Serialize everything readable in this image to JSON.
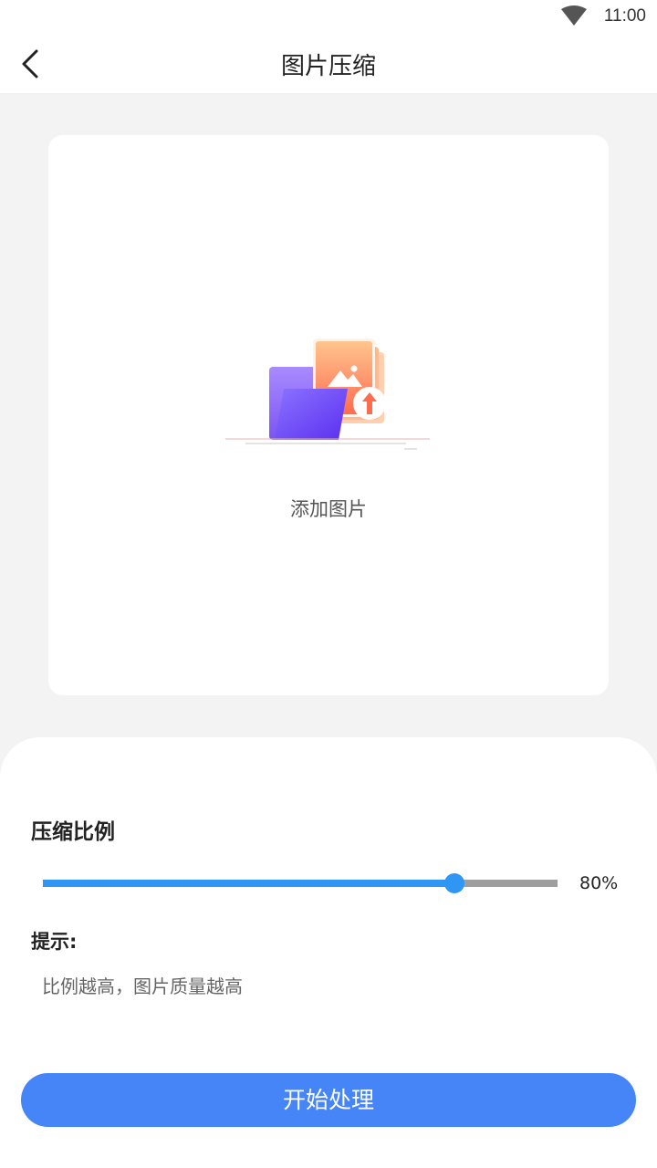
{
  "status_bar": {
    "time": "11:00",
    "icons": [
      "wifi-icon"
    ]
  },
  "header": {
    "title": "图片压缩",
    "back_icon": "back-arrow-icon"
  },
  "upload": {
    "label": "添加图片",
    "icon": "upload-image-folder-icon"
  },
  "compression": {
    "title": "压缩比例",
    "ratio": 0.8,
    "value_text": "80%"
  },
  "tip": {
    "title": "提示:",
    "text": "比例越高，图片质量越高"
  },
  "action": {
    "start_label": "开始处理"
  },
  "colors": {
    "accent": "#2f96f3",
    "button": "#4685f8",
    "background": "#f3f3f3"
  }
}
